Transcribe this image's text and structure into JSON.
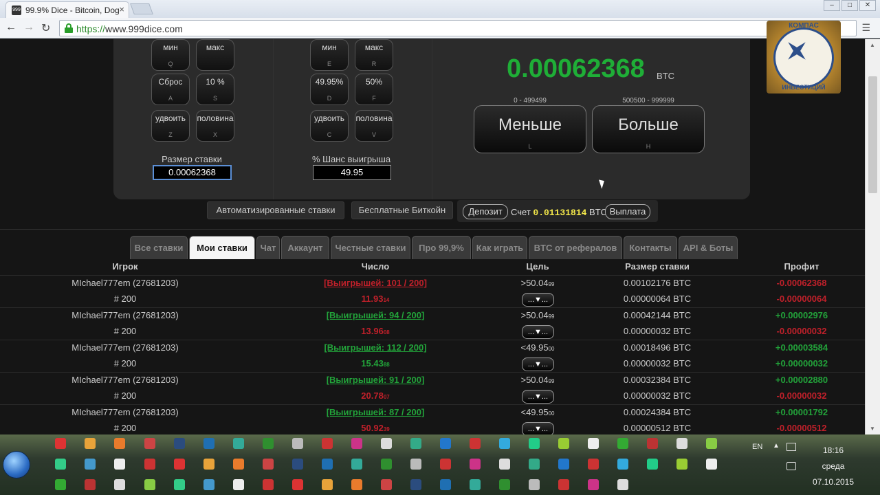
{
  "browser": {
    "tab_title": "99.9% Dice - Bitcoin, Dog",
    "favicon_text": "999",
    "tab_close": "×",
    "url_scheme": "https://",
    "url_host": "www.999dice.com",
    "back": "←",
    "forward": "→",
    "reload": "↻",
    "menu": "☰",
    "win_min": "–",
    "win_max": "□",
    "win_close": "✕"
  },
  "overlay_logo": {
    "top_text": "КОМПАС",
    "bottom_text": "ИНВЕСТИЦИЙ"
  },
  "controls": {
    "bet_buttons": [
      {
        "label": "мин",
        "key": "Q"
      },
      {
        "label": "макс",
        "key": ""
      },
      {
        "label": "Сброс",
        "key": "A"
      },
      {
        "label": "10 %",
        "key": "S"
      },
      {
        "label": "удвоить",
        "key": "Z"
      },
      {
        "label": "половина",
        "key": "X"
      }
    ],
    "chance_buttons": [
      {
        "label": "мин",
        "key": "E"
      },
      {
        "label": "макс",
        "key": "R"
      },
      {
        "label": "49.95%",
        "key": "D"
      },
      {
        "label": "50%",
        "key": "F"
      },
      {
        "label": "удвоить",
        "key": "C"
      },
      {
        "label": "половина",
        "key": "V"
      }
    ],
    "bet_size_label": "Размер ставки",
    "bet_size_value": "0.00062368",
    "chance_label": "% Шанс выигрыша",
    "chance_value": "49.95"
  },
  "bet_display": {
    "amount": "0.00062368",
    "unit": "BTC",
    "low_range": "0 - 499499",
    "high_range": "500500 - 999999",
    "low_label": "Меньше",
    "low_key": "L",
    "high_label": "Больше",
    "high_key": "H"
  },
  "subbar": {
    "auto_bets": "Автоматизированные ставки",
    "free_btc": "Бесплатные Биткойн",
    "deposit": "Депозит",
    "account_label": "Счет",
    "account_value": "0.01131814",
    "account_unit": "BTC",
    "withdraw": "Выплата"
  },
  "tabs": [
    {
      "label": "Все ставки"
    },
    {
      "label": "Мои ставки"
    },
    {
      "label": "Чат"
    },
    {
      "label": "Аккаунт"
    },
    {
      "label": "Честные ставки"
    },
    {
      "label": "Про 99,9%"
    },
    {
      "label": "Как играть"
    },
    {
      "label": "BTC от рефералов"
    },
    {
      "label": "Контакты"
    },
    {
      "label": "API & Боты"
    }
  ],
  "table": {
    "headers": {
      "player": "Игрок",
      "number": "Число",
      "target": "Цель",
      "bet": "Размер ставки",
      "profit": "Профит"
    },
    "select_label": "...▼...",
    "rows": [
      {
        "player": "MIchael777em (27681203)",
        "game": "# 200",
        "wins": "[Выигрышей: 101 / 200]",
        "wins_color": "red",
        "number": "11.93",
        "number_small": "14",
        "number_color": "red",
        "target": ">50.04",
        "target_small": "99",
        "bet1": "0.00102176 BTC",
        "bet2": "0.00000064 BTC",
        "profit1": "-0.00062368",
        "profit1_color": "red",
        "profit2": "-0.00000064",
        "profit2_color": "red"
      },
      {
        "player": "MIchael777em (27681203)",
        "game": "# 200",
        "wins": "[Выигрышей: 94 / 200]",
        "wins_color": "green",
        "number": "13.96",
        "number_small": "08",
        "number_color": "red",
        "target": ">50.04",
        "target_small": "99",
        "bet1": "0.00042144 BTC",
        "bet2": "0.00000032 BTC",
        "profit1": "+0.00002976",
        "profit1_color": "green",
        "profit2": "-0.00000032",
        "profit2_color": "red"
      },
      {
        "player": "MIchael777em (27681203)",
        "game": "# 200",
        "wins": "[Выигрышей: 112 / 200]",
        "wins_color": "green",
        "number": "15.43",
        "number_small": "88",
        "number_color": "green",
        "target": "<49.95",
        "target_small": "00",
        "bet1": "0.00018496 BTC",
        "bet2": "0.00000032 BTC",
        "profit1": "+0.00003584",
        "profit1_color": "green",
        "profit2": "+0.00000032",
        "profit2_color": "green"
      },
      {
        "player": "MIchael777em (27681203)",
        "game": "# 200",
        "wins": "[Выигрышей: 91 / 200]",
        "wins_color": "green",
        "number": "20.78",
        "number_small": "07",
        "number_color": "red",
        "target": ">50.04",
        "target_small": "99",
        "bet1": "0.00032384 BTC",
        "bet2": "0.00000032 BTC",
        "profit1": "+0.00002880",
        "profit1_color": "green",
        "profit2": "-0.00000032",
        "profit2_color": "red"
      },
      {
        "player": "MIchael777em (27681203)",
        "game": "# 200",
        "wins": "[Выигрышей: 87 / 200]",
        "wins_color": "green",
        "number": "50.92",
        "number_small": "39",
        "number_color": "red",
        "target": "<49.95",
        "target_small": "00",
        "bet1": "0.00024384 BTC",
        "bet2": "0.00000512 BTC",
        "profit1": "+0.00001792",
        "profit1_color": "green",
        "profit2": "-0.00000512",
        "profit2_color": "red"
      }
    ]
  },
  "taskbar": {
    "lang": "EN",
    "tray_up": "▲",
    "time": "18:16",
    "day": "среда",
    "date": "07.10.2015"
  },
  "colors": {
    "balance_green": "#1fae37",
    "profit_red": "#c0202a",
    "profit_green": "#22a33a",
    "account_yellow": "#f4e84a"
  }
}
